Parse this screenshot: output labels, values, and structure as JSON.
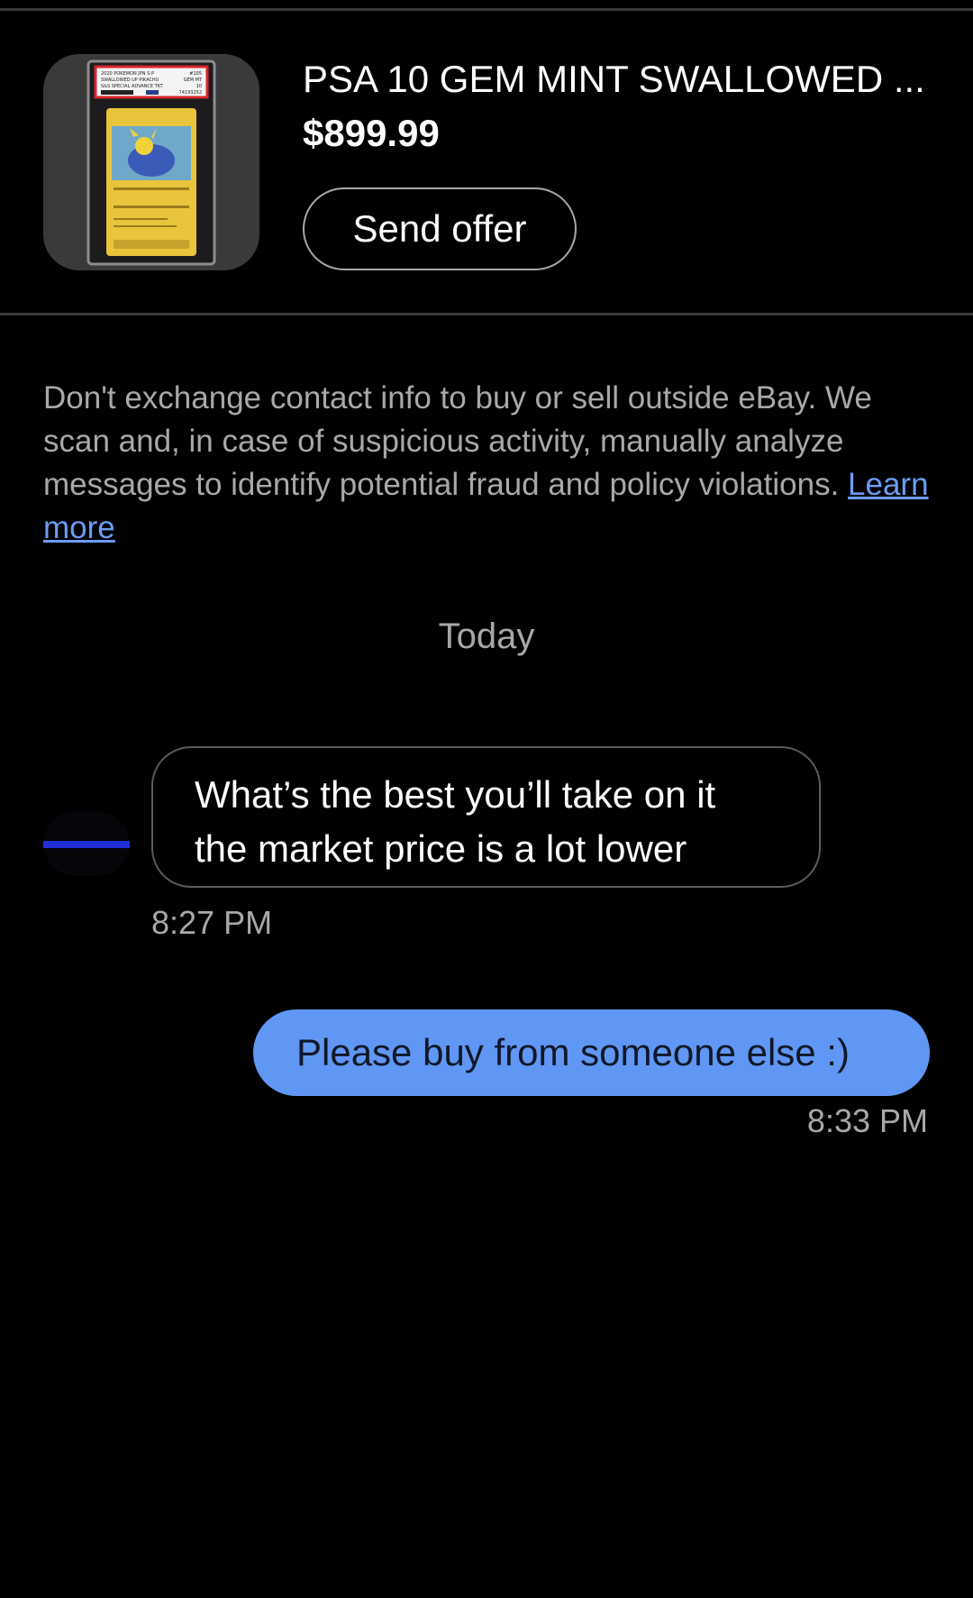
{
  "listing": {
    "title": "PSA 10 GEM MINT SWALLOWED ...",
    "price": "$899.99",
    "send_offer_label": "Send offer",
    "thumbnail_icon": "graded-card-slab-image",
    "slab_label": {
      "line1": "2020 POKEMON JPN S-P",
      "line2": "SWALLOWED UP PIKACHU",
      "line3": "S&S SPECIAL ADVANCE TKT",
      "grade_number": "#105",
      "grade_text": "GEM MT",
      "grade": "10",
      "cert": "74193252"
    }
  },
  "notice": {
    "text": "Don't exchange contact info to buy or sell outside eBay. We scan and, in case of suspicious activity, manually analyze messages to identify potential fraud and policy violations.",
    "link_label": "Learn more"
  },
  "conversation": {
    "date_label": "Today",
    "messages": [
      {
        "direction": "incoming",
        "line1": "What’s the best you’ll take on it",
        "line2": "the market price is a lot lower",
        "time": "8:27 PM"
      },
      {
        "direction": "outgoing",
        "text": "Please buy from someone else :)",
        "time": "8:33 PM"
      }
    ]
  },
  "colors": {
    "background": "#000000",
    "divider": "#3a3a3a",
    "muted_text": "#a8a8a8",
    "link": "#6d9cf7",
    "outgoing_bubble": "#6197f4",
    "incoming_border": "#5b5b5b",
    "avatar_accent": "#1e2fd6"
  }
}
